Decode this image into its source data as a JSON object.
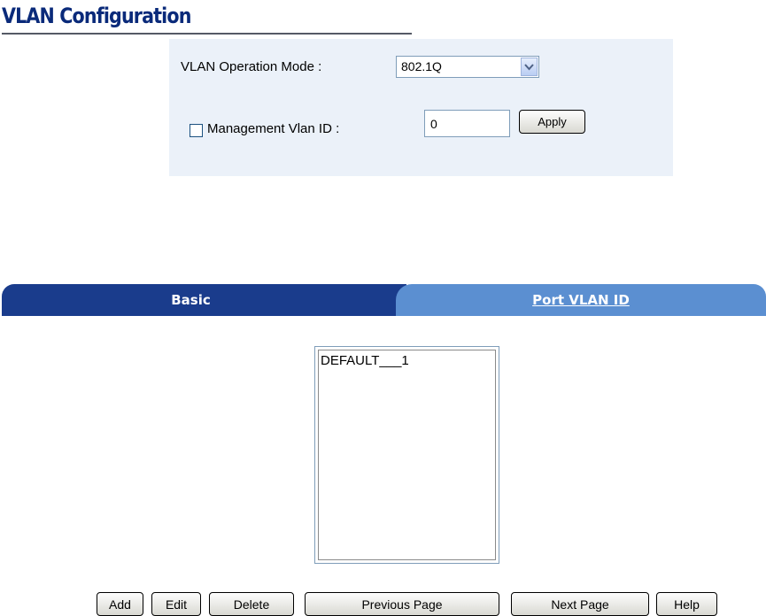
{
  "header": {
    "title": "VLAN Configuration"
  },
  "mode_panel": {
    "operation_mode_label": "VLAN Operation Mode :",
    "operation_mode_value": "802.1Q",
    "management_vlan_label": "Management Vlan ID :",
    "management_vlan_checked": false,
    "management_vlan_value": "0",
    "apply_label": "Apply"
  },
  "tabs": [
    {
      "label": "Basic",
      "active": true
    },
    {
      "label": "Port VLAN ID",
      "active": false
    }
  ],
  "vlan_list": {
    "items": [
      "DEFAULT___1"
    ]
  },
  "actions": {
    "add": "Add",
    "edit": "Edit",
    "delete": "Delete",
    "previous_page": "Previous Page",
    "next_page": "Next Page",
    "help": "Help"
  },
  "colors": {
    "title": "#0a2a7a",
    "panel_bg": "#ebf1f9",
    "tab_active": "#1a3c8c",
    "tab_inactive": "#5b8fd1"
  },
  "icons": {
    "select_arrow": "chevron-down-icon"
  }
}
